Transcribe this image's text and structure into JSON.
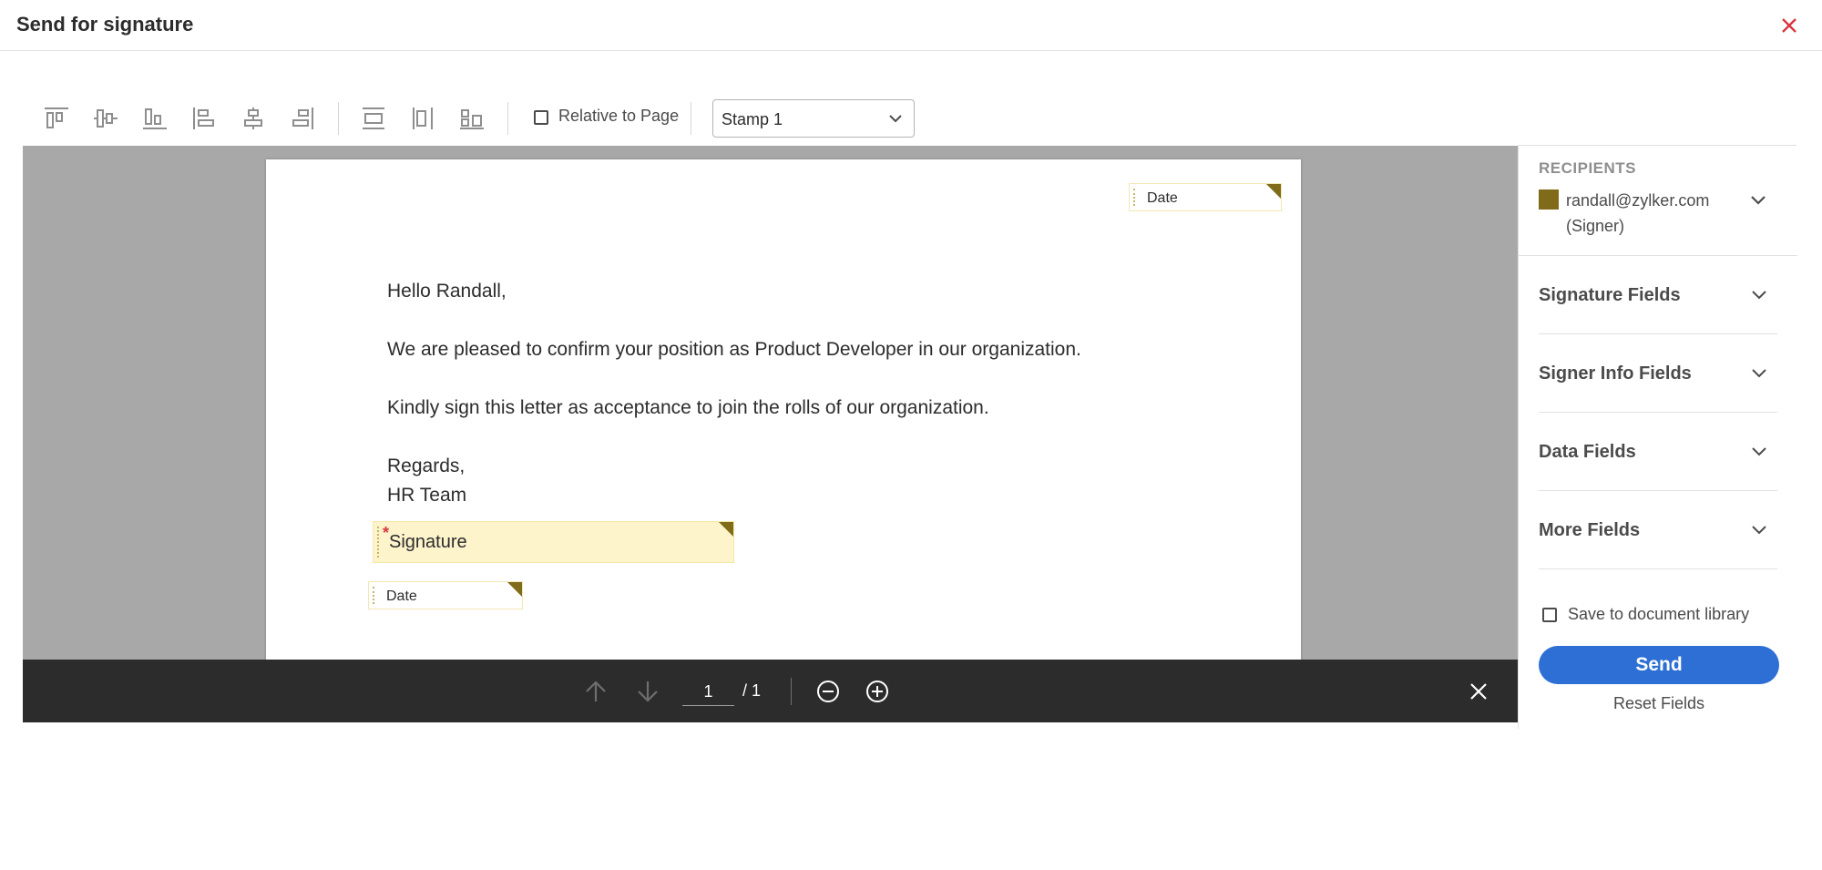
{
  "header": {
    "title": "Send for signature",
    "close_icon": "close-icon",
    "accent": "#d7373f"
  },
  "toolbar": {
    "align_icons": [
      "align-top-icon",
      "align-middle-icon",
      "align-bottom-icon",
      "align-left-icon",
      "align-center-icon",
      "align-right-icon"
    ],
    "distribute_icons": [
      "distribute-vertical-icon",
      "match-width-icon",
      "distribute-horizontal-icon"
    ],
    "relative_label": "Relative to Page",
    "stamp_value": "Stamp 1"
  },
  "document": {
    "lines": [
      "Hello Randall,",
      "We are pleased to confirm your position as Product Developer in our organization.",
      "Kindly sign this letter as acceptance to join the rolls of our organization.",
      "Regards,",
      "HR Team"
    ],
    "fields": {
      "top_date": "Date",
      "signature": "Signature",
      "signature_required_mark": "*",
      "bottom_date": "Date"
    }
  },
  "navigation": {
    "current_page": "1",
    "total_pages": "/ 1"
  },
  "sidebar": {
    "recipients_heading": "RECIPIENTS",
    "recipient": {
      "email": "randall@zylker.com",
      "role": "(Signer)",
      "color": "#806b1a"
    },
    "sections": [
      "Signature Fields",
      "Signer Info Fields",
      "Data Fields",
      "More Fields"
    ],
    "save_label": "Save to document library",
    "send_label": "Send",
    "reset_label": "Reset Fields"
  },
  "colors": {
    "primary_button": "#2d6fd4",
    "field_fill": "#fdf4cc",
    "field_corner": "#806b1a"
  }
}
